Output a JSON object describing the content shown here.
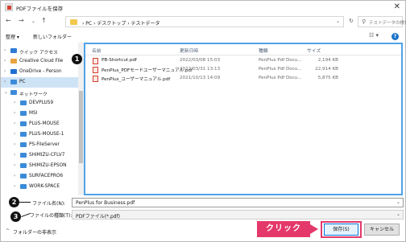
{
  "window": {
    "title": "PDFファイルを保存",
    "close": "✕"
  },
  "nav": {
    "back": "←",
    "forward": "→",
    "recent": "⌄",
    "up": "↑",
    "breadcrumb": "› PC › デスクトップ › テストデータ",
    "refresh": "↻",
    "search_placeholder": "テストデータの検索"
  },
  "commands": {
    "organize": "整理 ▾",
    "new_folder": "新しいフォルダー"
  },
  "sidebar": {
    "items": [
      {
        "label": "クイック アクセス",
        "chev": "›",
        "icon_color": "#2d7bd6"
      },
      {
        "label": "Creative Cloud File",
        "chev": "›",
        "icon_color": "#e8a33d"
      },
      {
        "label": "OneDrive - Person",
        "chev": "›",
        "icon_color": "#1f6fd1"
      },
      {
        "label": "PC",
        "chev": "›",
        "icon_color": "#3b8bd9"
      },
      {
        "label": "ネットワーク",
        "chev": "⌄",
        "icon_color": "#3b8bd9"
      },
      {
        "label": "DEVPLUS9",
        "chev": "›",
        "icon_color": "#3b8bd9"
      },
      {
        "label": "MSI",
        "chev": "›",
        "icon_color": "#3b8bd9"
      },
      {
        "label": "PLUS-MOUSE",
        "chev": "›",
        "icon_color": "#3b8bd9"
      },
      {
        "label": "PLUS-MOUSE-1",
        "chev": "›",
        "icon_color": "#3b8bd9"
      },
      {
        "label": "PS-FileServer",
        "chev": "›",
        "icon_color": "#3b8bd9"
      },
      {
        "label": "SHIMIZU-CFLV7",
        "chev": "›",
        "icon_color": "#3b8bd9"
      },
      {
        "label": "SHIMIZU-EPSON",
        "chev": "›",
        "icon_color": "#3b8bd9"
      },
      {
        "label": "SURFACEPRO6",
        "chev": "›",
        "icon_color": "#3b8bd9"
      },
      {
        "label": "WORK-SPACE",
        "chev": "›",
        "icon_color": "#3b8bd9"
      }
    ]
  },
  "filelist": {
    "headers": {
      "name": "名前",
      "date": "更新日時",
      "type": "種類",
      "size": "サイズ"
    },
    "rows": [
      {
        "name": "PB-Shortcut.pdf",
        "date": "2022/03/08 15:03",
        "type": "PenPlus Pdf Docu...",
        "size": "2,194 KB"
      },
      {
        "name": "PenPlus_PDFモードユーザーマニュアル.pdf",
        "date": "2022/03/31 13:13",
        "type": "PenPlus Pdf Docu...",
        "size": "22,914 KB"
      },
      {
        "name": "PenPlus_ユーザーマニュアル.pdf",
        "date": "2021/10/13 14:09",
        "type": "PenPlus Pdf Docu...",
        "size": "5,875 KB"
      }
    ]
  },
  "fields": {
    "filename_label": "ファイル名(N):",
    "filename_value": "PenPlus for Business.pdf",
    "filetype_label": "ファイルの種類(T):",
    "filetype_value": "PDFファイル(*.pdf)",
    "dropdown": "⌄"
  },
  "footer": {
    "hide_folders": "フォルダーの非表示",
    "hide_chev": "^",
    "save": "保存(S)",
    "cancel": "キャンセル",
    "callout": "クリック"
  },
  "markers": {
    "one": "1",
    "two": "2",
    "three": "3"
  },
  "colors": {
    "accent": "#4fa3e8",
    "callout": "#e4386a",
    "pdf_icon": "#d2402d"
  }
}
